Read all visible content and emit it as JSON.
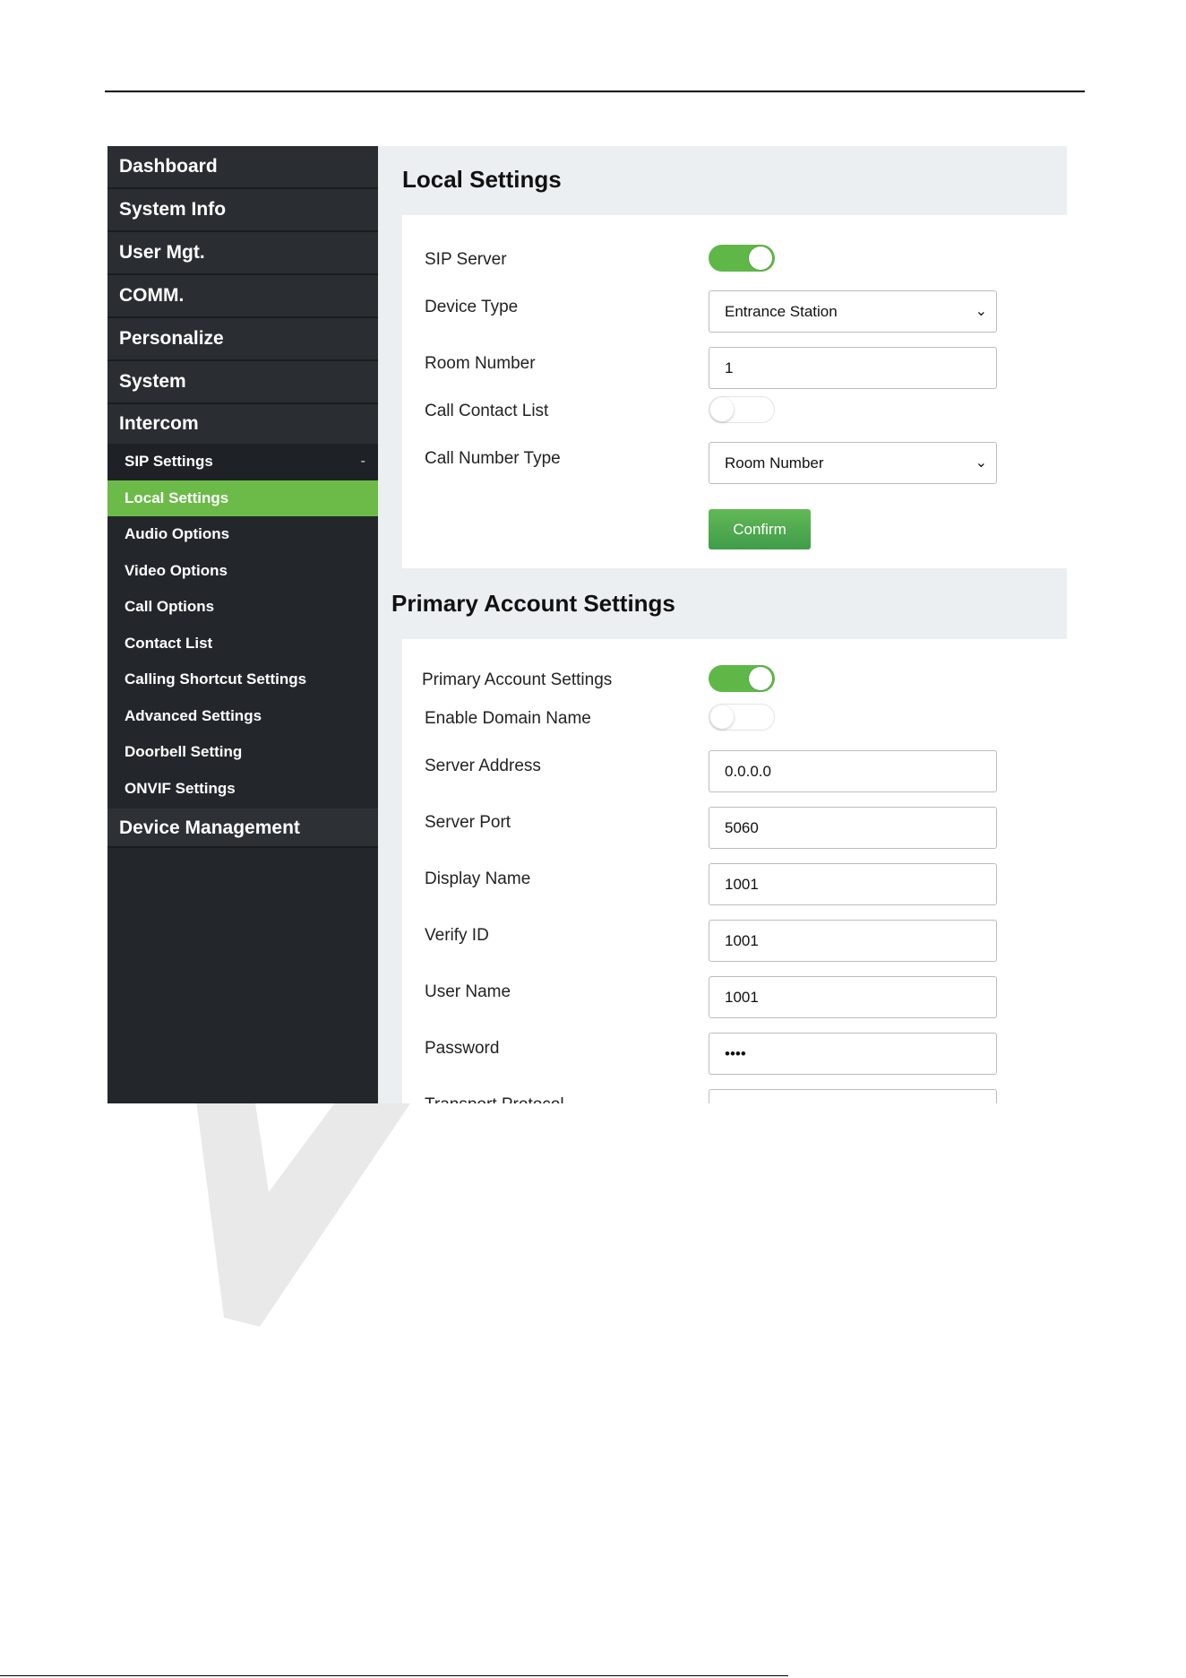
{
  "sidebar": {
    "menu_top": [
      {
        "label": "Dashboard"
      },
      {
        "label": "System Info"
      },
      {
        "label": "User Mgt."
      },
      {
        "label": "COMM."
      },
      {
        "label": "Personalize"
      },
      {
        "label": "System"
      },
      {
        "label": "Intercom"
      }
    ],
    "sip_settings": {
      "label": "SIP Settings",
      "collapse_sign": "-"
    },
    "sub_items": [
      {
        "label": "Local Settings",
        "active": true
      },
      {
        "label": "Audio Options"
      },
      {
        "label": "Video Options"
      },
      {
        "label": "Call Options"
      },
      {
        "label": "Contact List"
      },
      {
        "label": "Calling Shortcut Settings"
      },
      {
        "label": "Advanced Settings"
      },
      {
        "label": "Doorbell Setting"
      },
      {
        "label": "ONVIF Settings"
      }
    ],
    "device_management": {
      "label": "Device Management"
    }
  },
  "local_settings": {
    "title": "Local Settings",
    "sip_server": {
      "label": "SIP Server",
      "enabled": true
    },
    "device_type": {
      "label": "Device Type",
      "value": "Entrance Station"
    },
    "room_number": {
      "label": "Room Number",
      "value": "1"
    },
    "call_contact_list": {
      "label": "Call Contact List",
      "enabled": false
    },
    "call_number_type": {
      "label": "Call Number Type",
      "value": "Room Number"
    },
    "confirm_label": "Confirm"
  },
  "primary_account": {
    "title": "Primary Account Settings",
    "primary_account_settings": {
      "label": "Primary Account Settings",
      "enabled": true
    },
    "enable_domain_name": {
      "label": "Enable Domain Name",
      "enabled": false
    },
    "server_address": {
      "label": "Server Address",
      "value": "0.0.0.0"
    },
    "server_port": {
      "label": "Server Port",
      "value": "5060"
    },
    "display_name": {
      "label": "Display Name",
      "value": "1001"
    },
    "verify_id": {
      "label": "Verify ID",
      "value": "1001"
    },
    "user_name": {
      "label": "User Name",
      "value": "1001"
    },
    "password": {
      "label": "Password",
      "value": "••••"
    },
    "transport_protocol": {
      "label": "Transport Protocol"
    }
  },
  "colors": {
    "sidebar_bg": "#23272b",
    "active_green": "#6cba48",
    "toggle_on": "#5fb748",
    "main_bg": "#eceff1"
  },
  "icons": {
    "select_chevron": "chevron-down-icon"
  }
}
